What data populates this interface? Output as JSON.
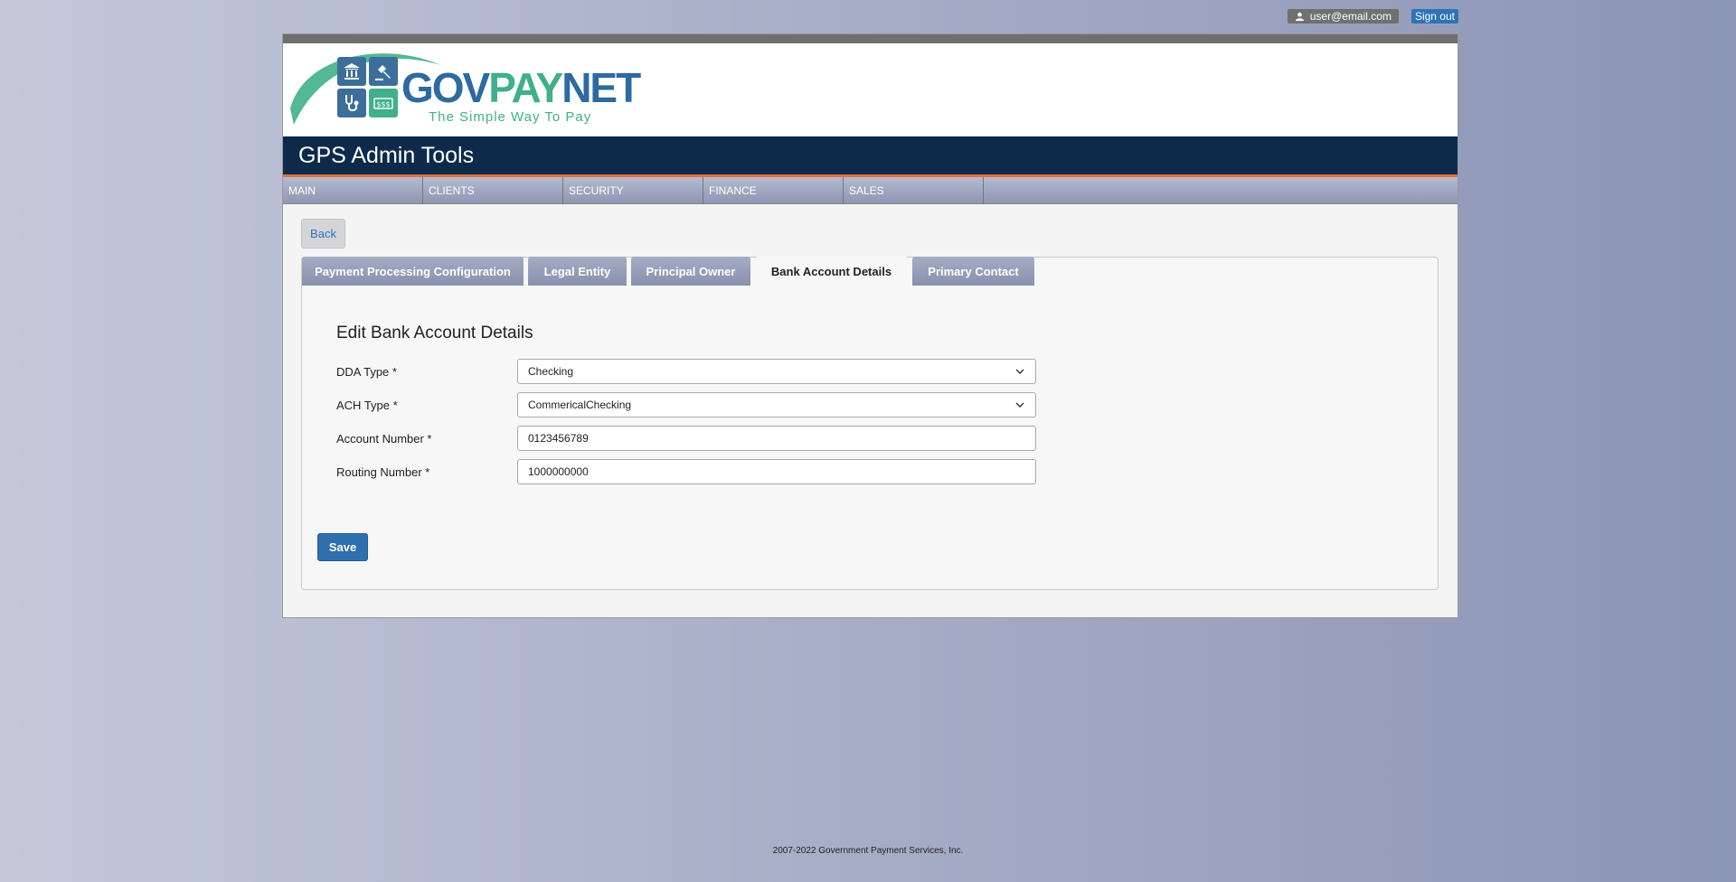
{
  "userbar": {
    "user_email": "user@email.com",
    "signout_label": "Sign out",
    "user_icon": "user-icon"
  },
  "logo": {
    "brand_gov": "GOV",
    "brand_pay": "PAY",
    "brand_net": "NET",
    "tagline": "The Simple Way To Pay"
  },
  "header": {
    "title": "GPS Admin Tools"
  },
  "nav": {
    "items": [
      {
        "label": "MAIN"
      },
      {
        "label": "CLIENTS"
      },
      {
        "label": "SECURITY"
      },
      {
        "label": "FINANCE"
      },
      {
        "label": "SALES"
      }
    ]
  },
  "back_label": "Back",
  "tabs": [
    {
      "label": "Payment Processing Configuration",
      "active": false
    },
    {
      "label": "Legal Entity",
      "active": false
    },
    {
      "label": "Principal Owner",
      "active": false
    },
    {
      "label": "Bank Account Details",
      "active": true
    },
    {
      "label": "Primary Contact",
      "active": false
    }
  ],
  "form": {
    "title": "Edit Bank Account Details",
    "fields": [
      {
        "label": "DDA Type *",
        "value": "Checking",
        "kind": "select"
      },
      {
        "label": "ACH Type *",
        "value": "CommericalChecking",
        "kind": "select"
      },
      {
        "label": "Account Number *",
        "value": "0123456789",
        "kind": "input"
      },
      {
        "label": "Routing Number *",
        "value": "1000000000",
        "kind": "input"
      }
    ],
    "save_label": "Save"
  },
  "footer": {
    "text": "2007-2022 Government Payment Services, Inc."
  },
  "colors": {
    "accent_blue": "#2e6fad",
    "header_navy": "#0d2a4a",
    "header_stripe": "#e0703a",
    "brand_green": "#3fb08a"
  }
}
